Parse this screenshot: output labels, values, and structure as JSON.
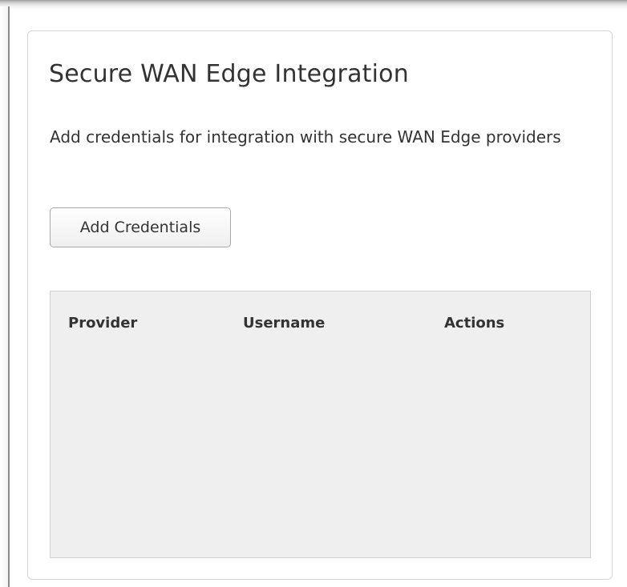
{
  "panel": {
    "title": "Secure WAN Edge Integration",
    "description": "Add credentials for integration with secure WAN Edge providers",
    "add_button_label": "Add Credentials"
  },
  "table": {
    "columns": [
      "Provider",
      "Username",
      "Actions"
    ],
    "rows": []
  }
}
